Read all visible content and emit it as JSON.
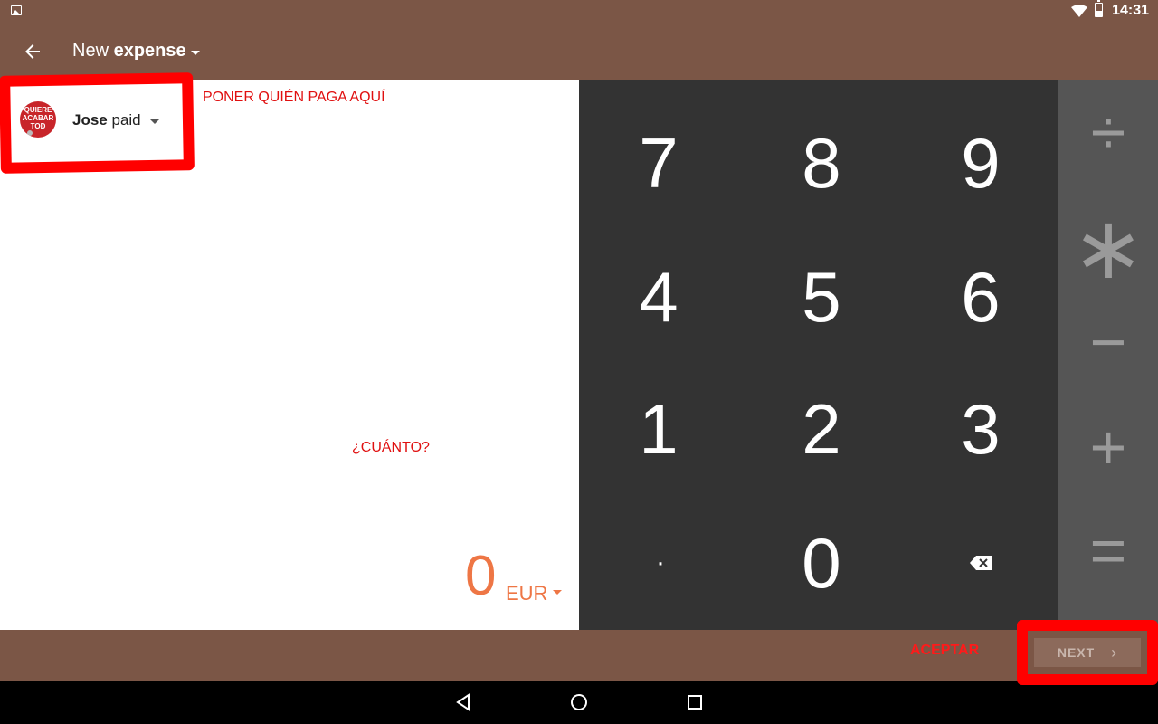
{
  "status_bar": {
    "time": "14:31"
  },
  "app_bar": {
    "title_prefix": "New",
    "title_bold": "expense"
  },
  "payer": {
    "name": "Jose",
    "suffix": "paid",
    "avatar_lines": [
      "QUIERE",
      "ACABAR",
      "TOD"
    ]
  },
  "annotations": {
    "who_pays": "PONER QUIÉN PAGA AQUÍ",
    "how_much": "¿CUÁNTO?",
    "accept": "ACEPTAR"
  },
  "amount": {
    "value": "0",
    "currency": "EUR"
  },
  "keypad": {
    "keys": [
      "7",
      "8",
      "9",
      "4",
      "5",
      "6",
      "1",
      "2",
      "3",
      "·",
      "0"
    ]
  },
  "operators": [
    "÷",
    "∗",
    "−",
    "+",
    "="
  ],
  "bottom": {
    "next_label": "NEXT"
  },
  "colors": {
    "primary": "#7b5646",
    "accent": "#ee7645",
    "keypad": "#333333",
    "operators": "#555555",
    "annotation": "#ff0000"
  }
}
